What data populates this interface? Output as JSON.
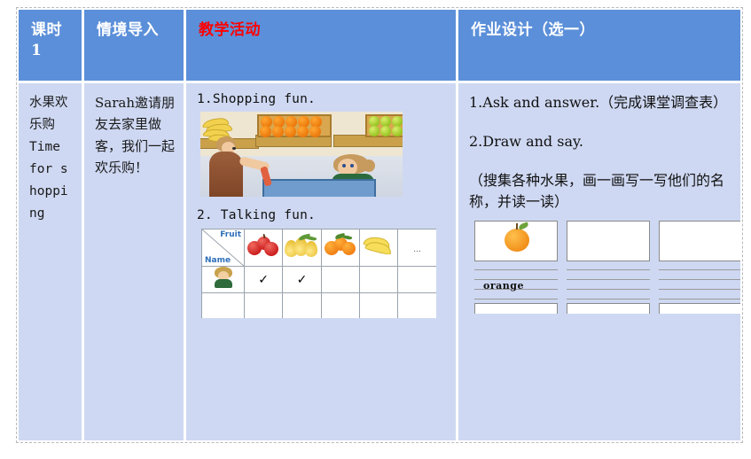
{
  "table": {
    "columns": [
      {
        "id": "period",
        "header": "课时",
        "header_line2": "1"
      },
      {
        "id": "context",
        "header": "情境导入"
      },
      {
        "id": "activity",
        "header": "教学活动",
        "header_color": "#ff0000"
      },
      {
        "id": "homework",
        "header": "作业设计（选一）"
      }
    ],
    "body": {
      "period": {
        "cn_title": "水果欢乐购",
        "en_title": "Time for shopping"
      },
      "context": {
        "text": "Sarah邀请朋友去家里做客，我们一起欢乐购！"
      },
      "activity": {
        "item1_label": "1.Shopping  fun.",
        "item2_label": "2. Talking  fun.",
        "illustration_name": "shopping-at-fruit-market",
        "survey_table": {
          "corner_top_label": "Fruit",
          "corner_bottom_label": "Name",
          "column_icons": [
            "apples",
            "pears",
            "oranges",
            "bananas",
            "..."
          ],
          "rows": [
            {
              "name_icon": "girl-avatar",
              "checks": [
                "✓",
                "✓",
                "",
                "",
                ""
              ]
            },
            {
              "name_icon": "",
              "checks": [
                "",
                "",
                "",
                "",
                ""
              ]
            }
          ]
        }
      },
      "homework": {
        "item1": "1.Ask  and    answer.（完成课堂调查表）",
        "item2": "2.Draw  and  say.",
        "item2_note": "（搜集各种水果，画一画写一写他们的名称，并读一读）",
        "cards": [
          {
            "icon": "orange-fruit",
            "word": "orange"
          },
          {
            "icon": "",
            "word": ""
          },
          {
            "icon": "",
            "word": ""
          }
        ]
      }
    }
  },
  "colors": {
    "header_bg": "#5b8fd9",
    "body_bg": "#ced8f2",
    "header_text": "#ffffff",
    "accent_red": "#ff0000",
    "grid_line": "#ffffff"
  }
}
